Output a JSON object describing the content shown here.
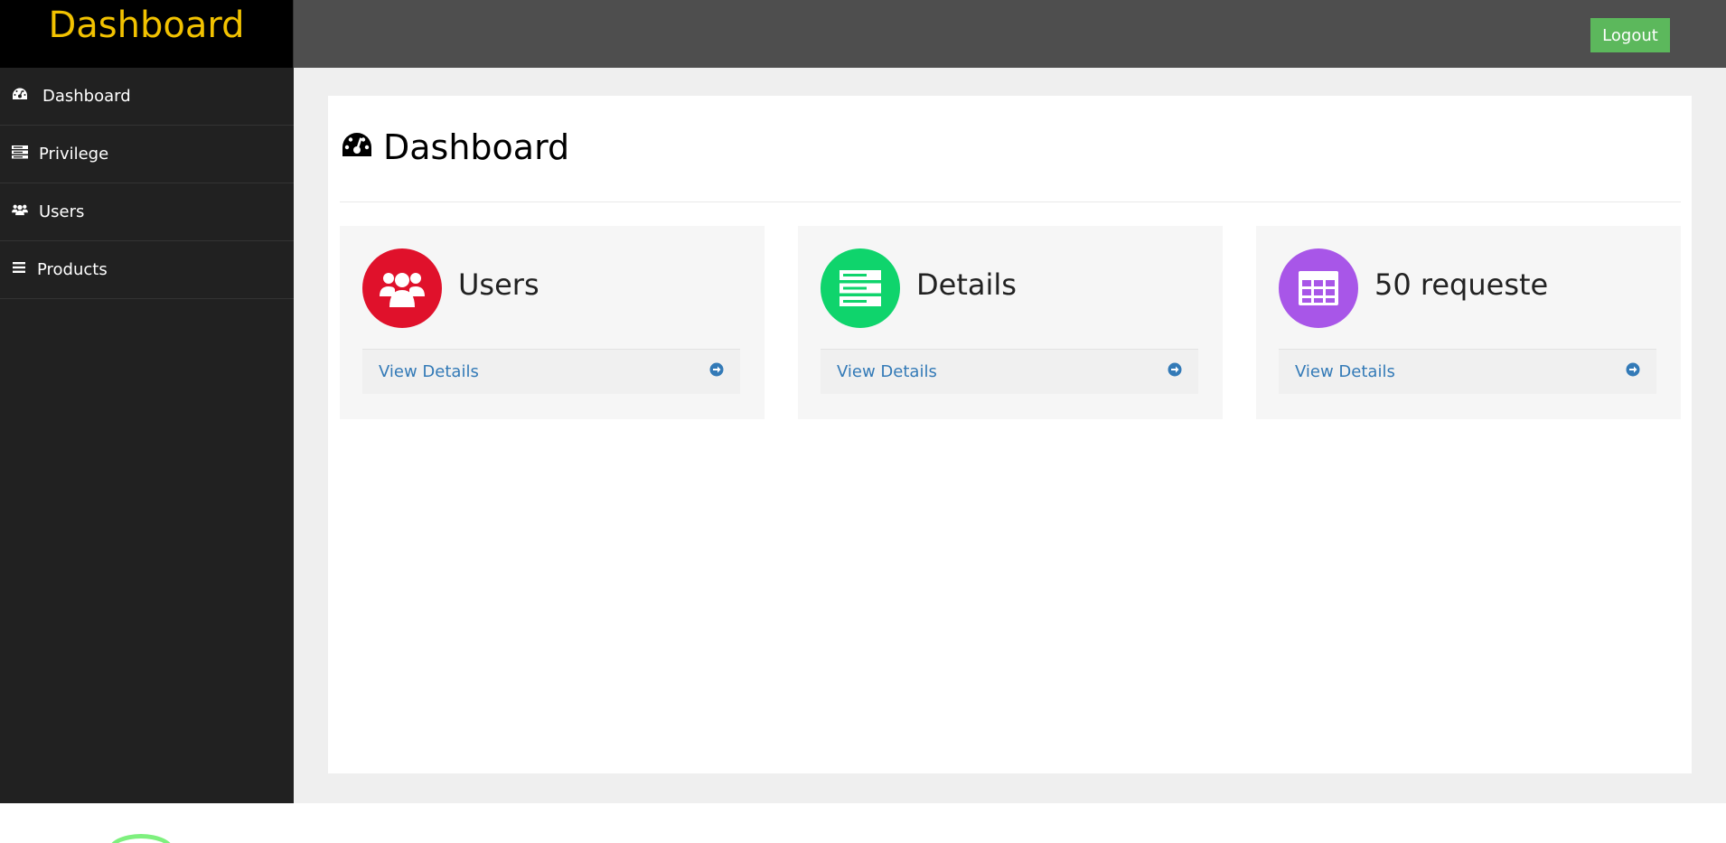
{
  "brand": {
    "title": "Dashboard"
  },
  "sidebar": {
    "items": [
      {
        "label": "Dashboard",
        "icon": "dashboard-icon"
      },
      {
        "label": "Privilege",
        "icon": "server-icon"
      },
      {
        "label": "Users",
        "icon": "users-icon"
      },
      {
        "label": "Products",
        "icon": "list-icon"
      }
    ]
  },
  "header": {
    "logout_label": "Logout"
  },
  "main": {
    "title": "Dashboard",
    "cards": [
      {
        "title": "Users",
        "link": "View Details",
        "color": "#e0112b",
        "icon": "users-icon"
      },
      {
        "title": "Details",
        "link": "View Details",
        "color": "#0fd46c",
        "icon": "server-icon"
      },
      {
        "title": "50 requeste",
        "link": "View Details",
        "color": "#a856e8",
        "icon": "table-icon"
      }
    ]
  },
  "colors": {
    "brand_text": "#f2c200",
    "sidebar_bg": "#212121",
    "topbar_bg": "#4e4e4e",
    "logout_bg": "#5cb85c",
    "link": "#337ab7"
  }
}
